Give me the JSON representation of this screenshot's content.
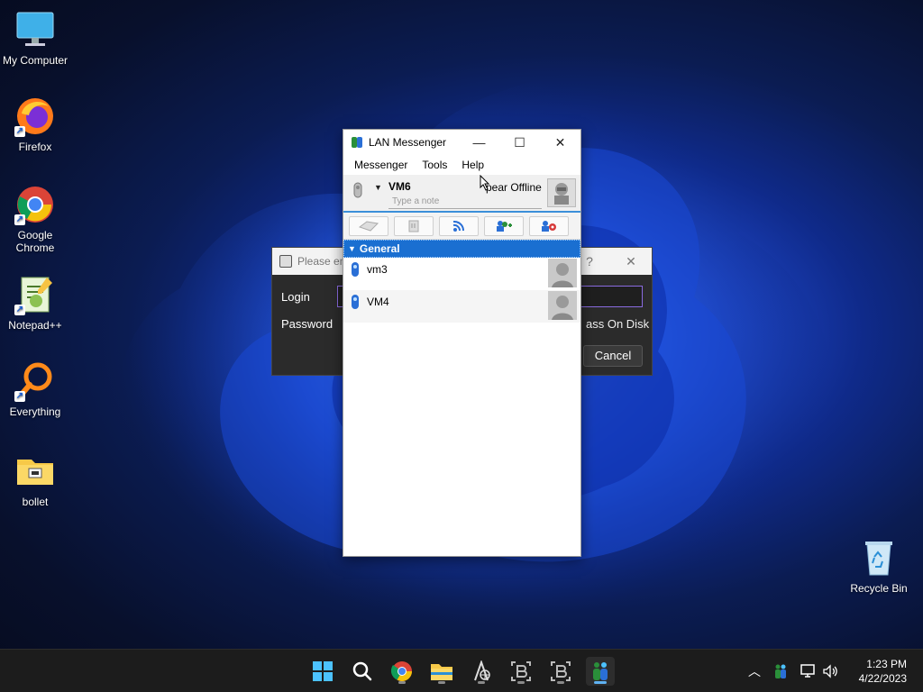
{
  "desktop": {
    "icons": [
      {
        "label": "My Computer",
        "icon": "monitor-icon"
      },
      {
        "label": "Firefox",
        "icon": "firefox-icon"
      },
      {
        "label": "Google Chrome",
        "icon": "chrome-icon"
      },
      {
        "label": "Notepad++",
        "icon": "notepad-plus-plus-icon"
      },
      {
        "label": "Everything",
        "icon": "everything-search-icon"
      },
      {
        "label": "bollet",
        "icon": "folder-icon"
      },
      {
        "label": "Recycle Bin",
        "icon": "recycle-bin-icon"
      }
    ]
  },
  "password_dialog": {
    "title": "Please en",
    "help_glyph": "?",
    "close_glyph": "✕",
    "login_label": "Login",
    "password_label": "Password",
    "store_pass_label": "ass On Disk",
    "cancel_label": "Cancel"
  },
  "lan_messenger": {
    "title": "LAN Messenger",
    "window_controls": {
      "minimize": "—",
      "maximize": "☐",
      "close": "✕"
    },
    "menu": [
      "Messenger",
      "Tools",
      "Help"
    ],
    "profile": {
      "name": "VM6",
      "status": "pear Offline",
      "note_placeholder": "Type a note"
    },
    "toolbar": [
      "chat-icon",
      "file-transfer-icon",
      "broadcast-icon",
      "add-contact-icon",
      "group-settings-icon"
    ],
    "group": {
      "name": "General",
      "expanded": true
    },
    "contacts": [
      {
        "name": "vm3"
      },
      {
        "name": "VM4"
      }
    ]
  },
  "taskbar": {
    "apps": [
      "start-icon",
      "search-icon",
      "chrome-icon",
      "file-explorer-icon",
      "network-tool-icon",
      "app-b-icon",
      "app-b-icon",
      "lan-messenger-icon"
    ],
    "tray": [
      "chevron-up-icon",
      "lan-messenger-tray-icon",
      "network-icon",
      "volume-icon"
    ],
    "time": "1:23 PM",
    "date": "4/22/2023"
  }
}
